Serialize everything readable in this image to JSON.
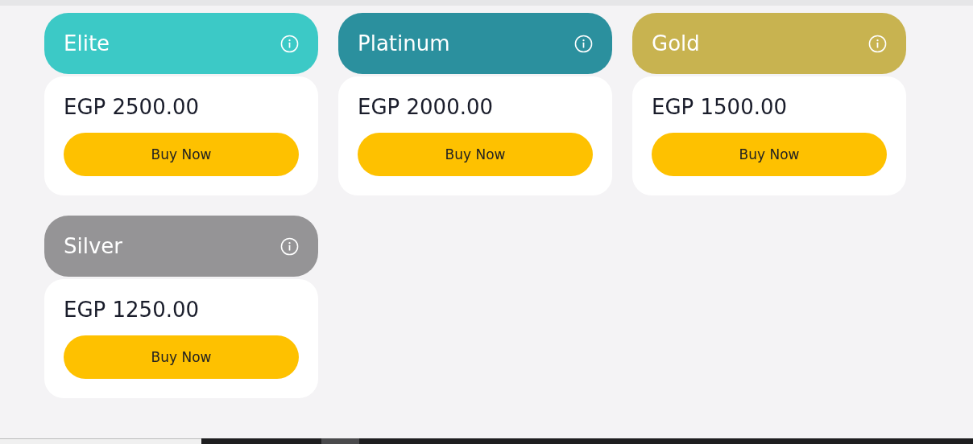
{
  "plans": [
    {
      "name": "Elite",
      "color": "#3cc9c6",
      "price": "EGP 2500.00",
      "button": "Buy Now"
    },
    {
      "name": "Platinum",
      "color": "#2b909e",
      "price": "EGP 2000.00",
      "button": "Buy Now"
    },
    {
      "name": "Gold",
      "color": "#c8b350",
      "price": "EGP 1500.00",
      "button": "Buy Now"
    },
    {
      "name": "Silver",
      "color": "#959496",
      "price": "EGP 1250.00",
      "button": "Buy Now"
    }
  ]
}
